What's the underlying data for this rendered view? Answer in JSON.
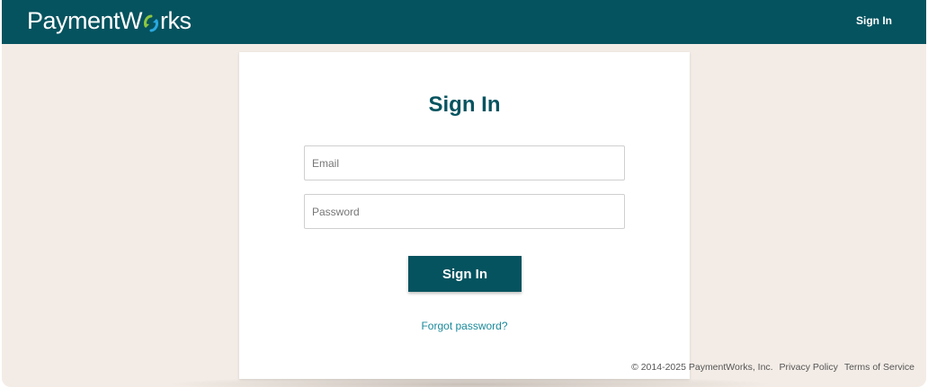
{
  "header": {
    "logo_prefix": "PaymentW",
    "logo_suffix": "rks",
    "logo_mark_icon": "paymentworks-o-arrows-icon",
    "nav_signin": "Sign In"
  },
  "signin_card": {
    "title": "Sign In",
    "email_placeholder": "Email",
    "email_value": "",
    "password_placeholder": "Password",
    "password_value": "",
    "submit_label": "Sign In",
    "forgot_link": "Forgot password?"
  },
  "footer": {
    "copyright": "© 2014-2025 PaymentWorks, Inc.",
    "privacy": "Privacy Policy",
    "terms": "Terms of Service"
  },
  "colors": {
    "brand_teal": "#05535f",
    "link_teal": "#1a8a9a",
    "page_background": "#f3ece6",
    "logo_green": "#8dc63f",
    "logo_blue": "#29a8e0"
  }
}
